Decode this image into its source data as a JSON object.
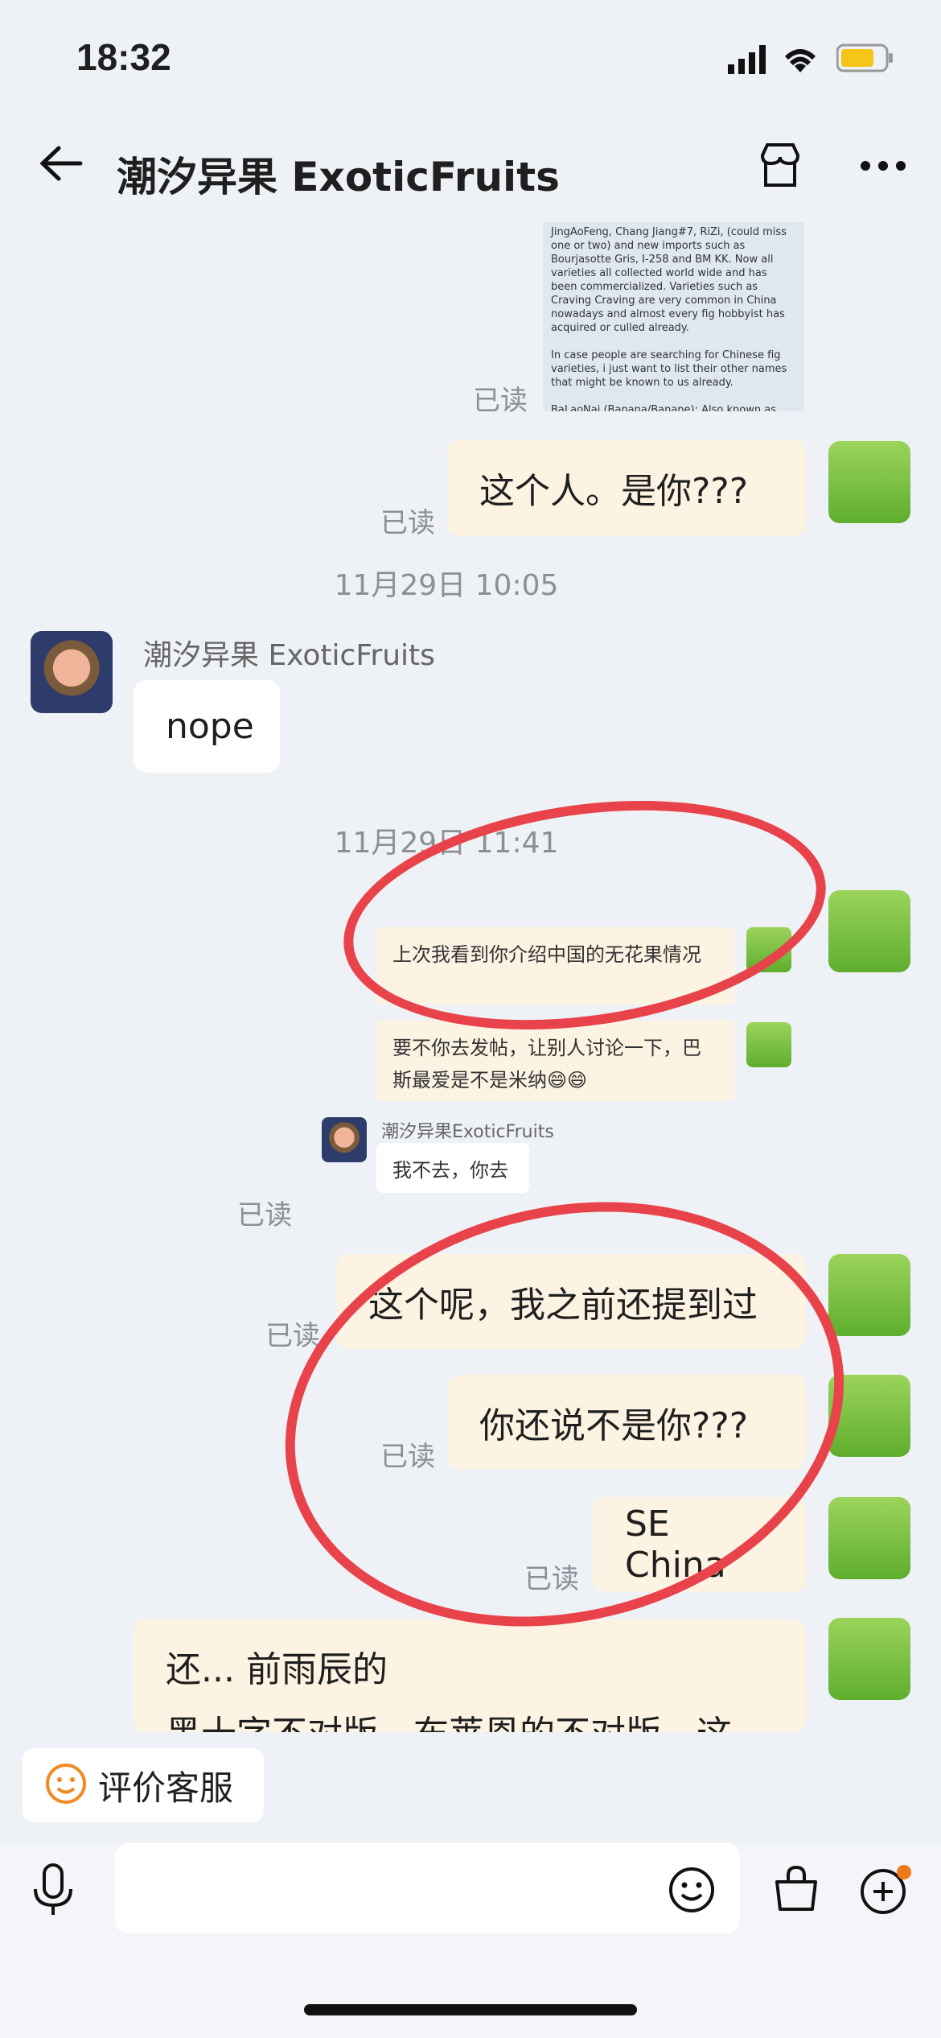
{
  "status_bar": {
    "time": "18:32"
  },
  "header": {
    "title": "潮汐异果 ExoticFruits"
  },
  "forwarded_doc": {
    "text": "JingAoFeng, Chang Jiang#7, RiZi, (could miss one or two) and new imports such as Bourjasotte Gris, I-258 and BM KK. Now all varieties all collected world wide and has been commercialized. Varieties such as Craving Craving are very common in China nowadays and almost every fig hobbyist has acquired or culled already.\n\nIn case people are searching for Chinese fig varieties, i just want to list their other names that might be known to us already.\n\nBaLaoNai (Banana/Banane): Also known as"
  },
  "messages": {
    "read_label": "已读",
    "msg1": "这个人。是你???",
    "time1": "11月29日 10:05",
    "sender": "潮汐异果 ExoticFruits",
    "msg2": "nope",
    "time2": "11月29日 11:41",
    "q1": "上次我看到你介绍中国的无花果情况",
    "q2": "要不你去发帖，让别人讨论一下，巴斯最爱是不是米纳😄😄",
    "q3_sender": "潮汐异果ExoticFruits",
    "q3": "我不去，你去",
    "msg3": "这个呢，我之前还提到过",
    "msg4": "你还说不是你???",
    "msg5": "SE China",
    "msg6_line1": "还... 前雨辰的",
    "msg6_line2": "黑十字不对版，布莱恩的不对版，这"
  },
  "bottom": {
    "rate_label": "评价客服"
  }
}
